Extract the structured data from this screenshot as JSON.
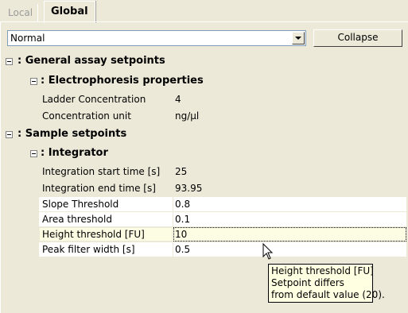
{
  "tabs": [
    {
      "label": "Local",
      "active": false
    },
    {
      "label": "Global",
      "active": true
    }
  ],
  "toolbar": {
    "preset_value": "Normal",
    "collapse_label": "Collapse"
  },
  "tree": {
    "general": {
      "label": ": General assay setpoints",
      "electrophoresis": {
        "label": ": Electrophoresis properties",
        "props": [
          {
            "name": "Ladder Concentration",
            "value": "4"
          },
          {
            "name": "Concentration unit",
            "value": "ng/µl"
          }
        ]
      }
    },
    "sample": {
      "label": ": Sample setpoints",
      "integrator": {
        "label": ": Integrator",
        "props": [
          {
            "name": "Integration start time [s]",
            "value": "25"
          },
          {
            "name": "Integration end time [s]",
            "value": "93.95"
          },
          {
            "name": "Slope Threshold",
            "value": "0.8"
          },
          {
            "name": "Area threshold",
            "value": "0.1"
          },
          {
            "name": "Height threshold [FU]",
            "value": "10"
          },
          {
            "name": "Peak filter width [s]",
            "value": "0.5"
          }
        ]
      }
    }
  },
  "tooltip": {
    "line1": "Height threshold [FU]",
    "line2": "Setpoint differs",
    "line3": "from default value (20)."
  },
  "colors": {
    "panel_bg": "#ece9d8",
    "highlight_row": "#fdfde3",
    "tooltip_bg": "#ffffe1"
  }
}
